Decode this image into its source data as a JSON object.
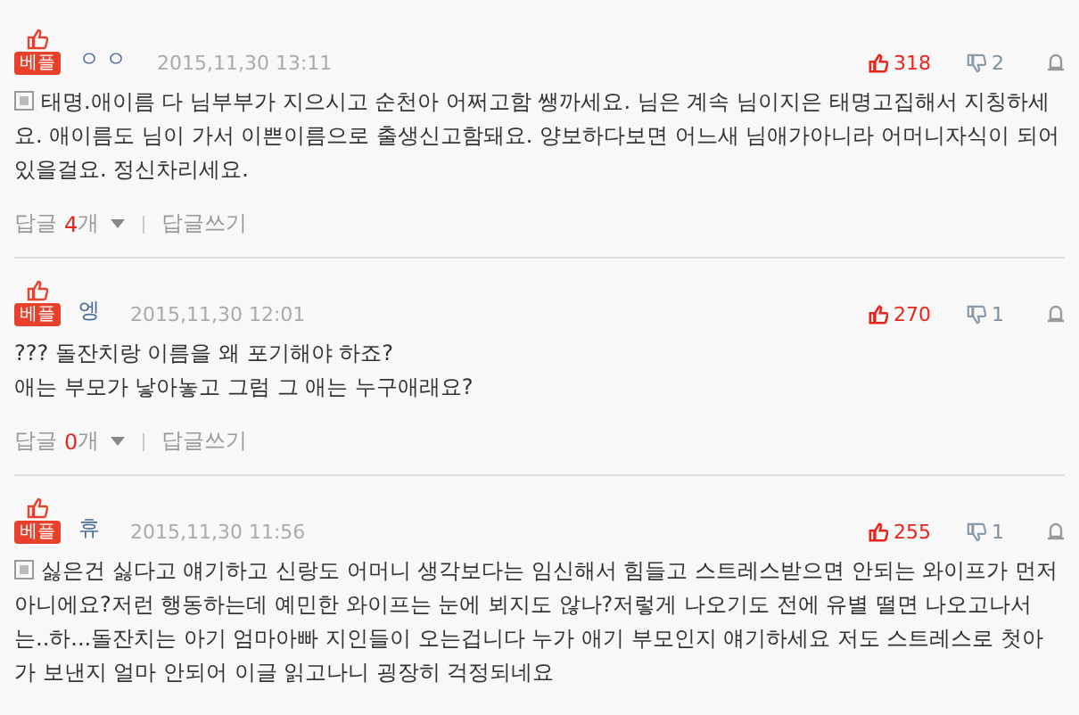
{
  "comments": [
    {
      "badge": "베플",
      "author": "ㅇㅇ",
      "date": "2015,11,30 13:11",
      "likes": "318",
      "dislikes": "2",
      "mobile": true,
      "body": [
        "태명.애이름 다 님부부가 지으시고 순천아 어쩌고함 쌩까세요. 님은 계속 님이지은 태명고집해서 지칭하세요. 애이름도 님이 가서 이쁜이름으로 출생신고함돼요. 양보하다보면 어느새 님애가아니라 어머니자식이 되어있을걸요. 정신차리세요."
      ],
      "replies": {
        "label": "답글",
        "count": "4",
        "unit": "개",
        "write": "답글쓰기"
      }
    },
    {
      "badge": "베플",
      "author": "엥",
      "date": "2015,11,30 12:01",
      "likes": "270",
      "dislikes": "1",
      "mobile": false,
      "body": [
        "??? 돌잔치랑 이름을 왜 포기해야 하죠?",
        "애는 부모가 낳아놓고 그럼 그 애는 누구애래요?"
      ],
      "replies": {
        "label": "답글",
        "count": "0",
        "unit": "개",
        "write": "답글쓰기"
      }
    },
    {
      "badge": "베플",
      "author": "휴",
      "date": "2015,11,30 11:56",
      "likes": "255",
      "dislikes": "1",
      "mobile": true,
      "body": [
        "싫은건 싫다고 얘기하고 신랑도 어머니 생각보다는 임신해서 힘들고 스트레스받으면 안되는 와이프가 먼저 아니에요?저런 행동하는데 예민한 와이프는 눈에 뵈지도 않나?저렇게 나오기도 전에 유별 떨면 나오고나서는..하...돌잔치는 아기 엄마아빠 지인들이 오는겁니다 누가 애기 부모인지 얘기하세요 저도 스트레스로 첫아가 보낸지 얼마 안되어 이글 읽고나니 굉장히 걱정되네요"
      ]
    }
  ]
}
